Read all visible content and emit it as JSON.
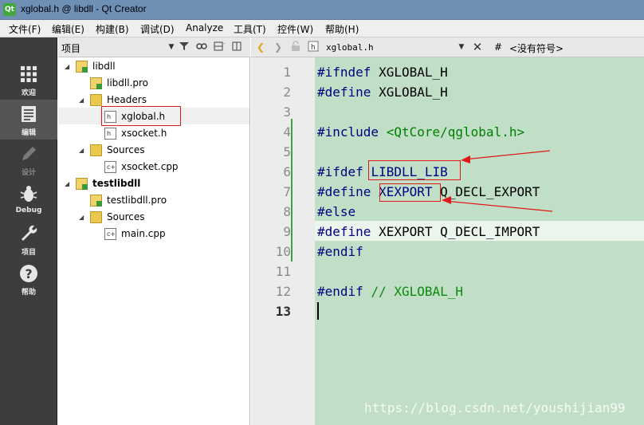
{
  "window": {
    "title": "xglobal.h @ libdll - Qt Creator",
    "app_icon": "Qt"
  },
  "menu": [
    "文件(F)",
    "编辑(E)",
    "构建(B)",
    "调试(D)",
    "Analyze",
    "工具(T)",
    "控件(W)",
    "帮助(H)"
  ],
  "modes": [
    {
      "label": "欢迎",
      "icon": "welcome-grid-icon",
      "active": false
    },
    {
      "label": "编辑",
      "icon": "edit-document-icon",
      "active": true
    },
    {
      "label": "设计",
      "icon": "design-pencil-icon",
      "active": false,
      "disabled": true
    },
    {
      "label": "Debug",
      "icon": "debug-bug-icon",
      "active": false
    },
    {
      "label": "项目",
      "icon": "projects-wrench-icon",
      "active": false
    },
    {
      "label": "帮助",
      "icon": "help-question-icon",
      "active": false
    }
  ],
  "project_pane": {
    "title": "项目",
    "tree": [
      {
        "label": "libdll",
        "type": "project",
        "level": 0,
        "bold": false
      },
      {
        "label": "libdll.pro",
        "type": "pro-file",
        "level": 1
      },
      {
        "label": "Headers",
        "type": "folder",
        "level": 1
      },
      {
        "label": "xglobal.h",
        "type": "header-file",
        "level": 2,
        "selected": true
      },
      {
        "label": "xsocket.h",
        "type": "header-file",
        "level": 2
      },
      {
        "label": "Sources",
        "type": "folder",
        "level": 1
      },
      {
        "label": "xsocket.cpp",
        "type": "source-file",
        "level": 2
      },
      {
        "label": "testlibdll",
        "type": "project",
        "level": 0,
        "bold": true
      },
      {
        "label": "testlibdll.pro",
        "type": "pro-file",
        "level": 1
      },
      {
        "label": "Sources",
        "type": "folder",
        "level": 1
      },
      {
        "label": "main.cpp",
        "type": "source-file",
        "level": 2
      }
    ]
  },
  "editor": {
    "file_name": "xglobal.h",
    "hash": "#",
    "symbol": "<没有符号>",
    "current_line": 9,
    "lines": [
      {
        "n": "1",
        "parts": [
          [
            "kw",
            "#ifndef"
          ],
          [
            "txt",
            " XGLOBAL_H"
          ]
        ]
      },
      {
        "n": "2",
        "parts": [
          [
            "kw",
            "#define"
          ],
          [
            "txt",
            " XGLOBAL_H"
          ]
        ]
      },
      {
        "n": "3",
        "parts": []
      },
      {
        "n": "4",
        "parts": [
          [
            "kw",
            "#include"
          ],
          [
            "txt",
            " "
          ],
          [
            "str",
            "<QtCore/qglobal.h>"
          ]
        ]
      },
      {
        "n": "5",
        "parts": []
      },
      {
        "n": "6",
        "parts": [
          [
            "kw",
            "#ifdef"
          ],
          [
            "txt",
            " "
          ],
          [
            "mac",
            "LIBDLL_LIB"
          ]
        ]
      },
      {
        "n": "7",
        "parts": [
          [
            "kw",
            "#define"
          ],
          [
            "txt",
            " "
          ],
          [
            "mac",
            "XEXPORT"
          ],
          [
            "txt",
            " Q_DECL_EXPORT"
          ]
        ]
      },
      {
        "n": "8",
        "parts": [
          [
            "kw",
            "#else"
          ]
        ]
      },
      {
        "n": "9",
        "parts": [
          [
            "kw",
            "#define"
          ],
          [
            "txt",
            " XEXPORT Q_DECL_IMPORT"
          ]
        ]
      },
      {
        "n": "10",
        "parts": [
          [
            "kw",
            "#endif"
          ]
        ]
      },
      {
        "n": "11",
        "parts": []
      },
      {
        "n": "12",
        "parts": [
          [
            "kw",
            "#endif"
          ],
          [
            "txt",
            " "
          ],
          [
            "cmt",
            "// XGLOBAL_H"
          ]
        ]
      },
      {
        "n": "13",
        "parts": []
      }
    ]
  },
  "watermark": "https://blog.csdn.net/youshijian99",
  "colors": {
    "annotation_red": "#e01818",
    "editor_bg": "#c1dfc7",
    "mode_bar": "#3d3d3d"
  }
}
